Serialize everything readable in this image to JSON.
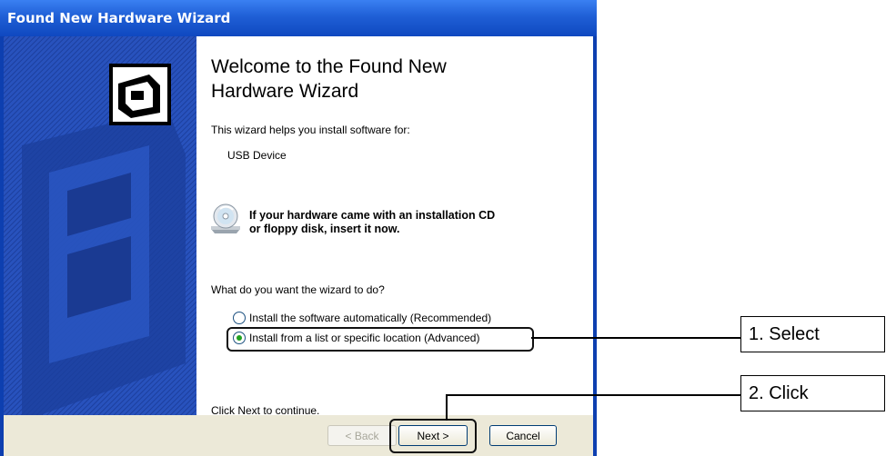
{
  "window": {
    "title": "Found New Hardware Wizard"
  },
  "wizard": {
    "heading_line1": "Welcome to the Found New",
    "heading_line2": "Hardware Wizard",
    "intro": "This wizard helps you install software for:",
    "device": "USB Device",
    "cd_line1": "If your hardware came with an installation CD",
    "cd_line2": "or floppy disk, insert it now.",
    "question": "What do you want the wizard to do?",
    "options": [
      {
        "label": "Install the software automatically (Recommended)",
        "selected": false
      },
      {
        "label": "Install from a list or specific location (Advanced)",
        "selected": true
      }
    ],
    "continue_text": "Click Next to continue."
  },
  "buttons": {
    "back": "< Back",
    "next": "Next >",
    "cancel": "Cancel"
  },
  "annotations": {
    "step1": "1. Select",
    "step2": "2. Click"
  },
  "colors": {
    "title_bar": "#1f5fd6",
    "left_panel": "#2049b4",
    "button_bar": "#ece9d8",
    "radio_check": "#21a121"
  }
}
